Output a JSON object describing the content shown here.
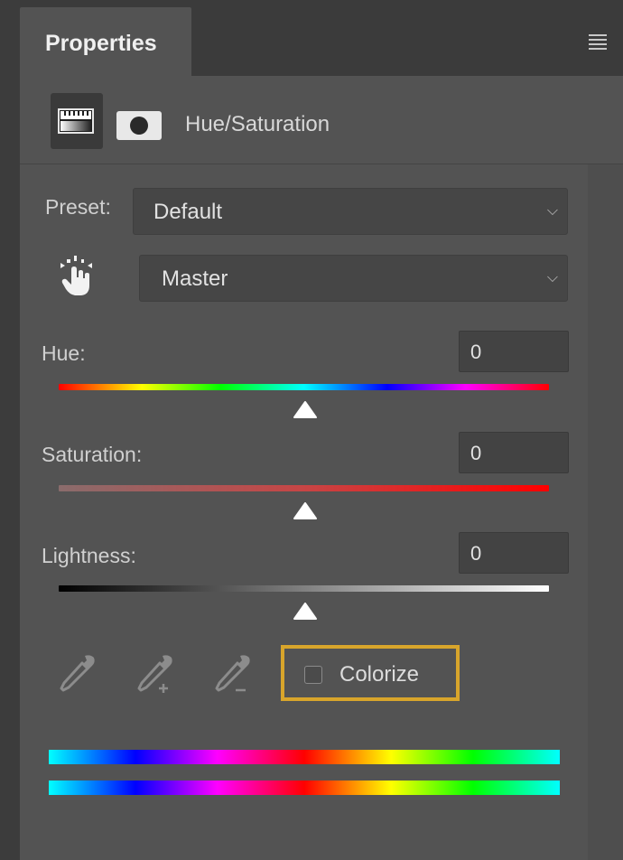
{
  "panel": {
    "tab_title": "Properties",
    "menu_icon": "hamburger-menu-icon"
  },
  "adjustment": {
    "title": "Hue/Saturation",
    "layer_icon": "hue-saturation-layer-icon",
    "mask_icon": "layer-mask-icon"
  },
  "preset": {
    "label": "Preset:",
    "value": "Default"
  },
  "channel": {
    "value": "Master",
    "tool_icon": "targeted-adjustment-hand-icon"
  },
  "hue": {
    "label": "Hue:",
    "value": "0"
  },
  "saturation": {
    "label": "Saturation:",
    "value": "0"
  },
  "lightness": {
    "label": "Lightness:",
    "value": "0"
  },
  "tools": {
    "eyedropper_icon": "eyedropper-icon",
    "eyedropper_add_icon": "eyedropper-add-icon",
    "eyedropper_subtract_icon": "eyedropper-subtract-icon"
  },
  "colorize": {
    "label": "Colorize",
    "checked": false,
    "highlight_color": "#d8a52b"
  },
  "colors": {
    "panel_bg": "#535353",
    "header_bg": "#3b3b3b",
    "field_bg": "#464646",
    "text": "#d6d6d6"
  }
}
